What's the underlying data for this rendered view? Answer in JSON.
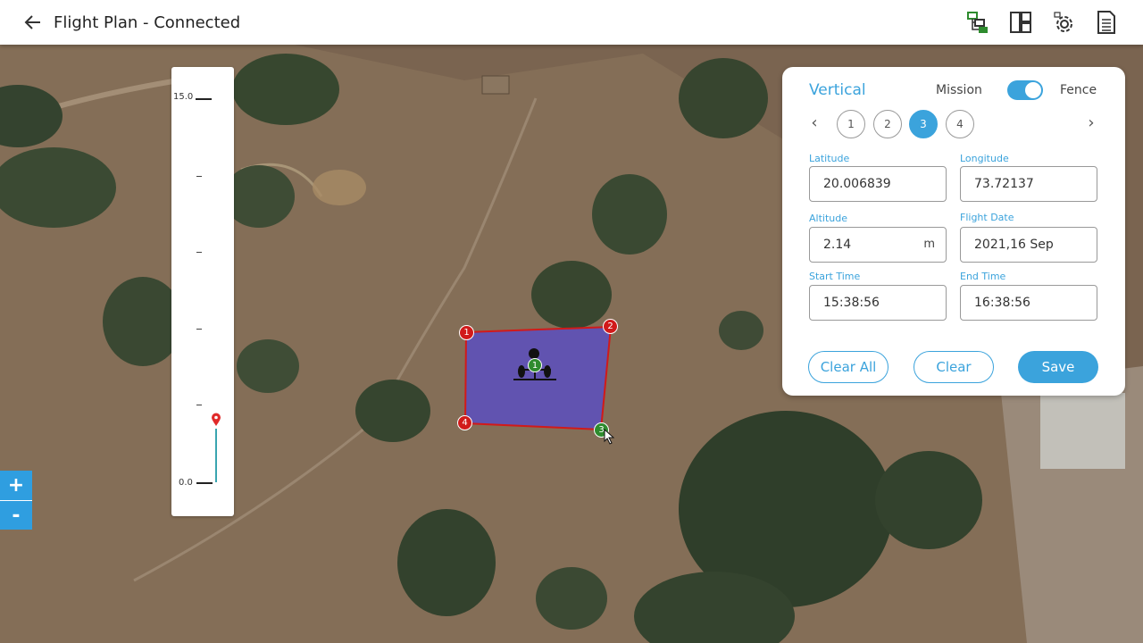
{
  "header": {
    "title": "Flight Plan - Connected"
  },
  "icons": {
    "back": "arrow-left-icon",
    "toolbar": [
      "mission-tree-icon",
      "layout-dashboard-icon",
      "settings-gear-icon",
      "document-list-icon"
    ]
  },
  "altitude_scale": {
    "max_label": "15.0",
    "min_label": "0.0",
    "marker_color": "#e02a2a"
  },
  "zoom": {
    "in_label": "+",
    "out_label": "-"
  },
  "map": {
    "polygon_fill": "#5b4fc0",
    "polygon_stroke": "#d11a1a",
    "vertex_labels": [
      "1",
      "2",
      "3",
      "4"
    ],
    "drone_waypoint_label": "1"
  },
  "panel": {
    "mode_label": "Vertical",
    "mission_label": "Mission",
    "fence_label": "Fence",
    "toggle_on": true,
    "prev_label": "‹",
    "next_label": "›",
    "steps": [
      "1",
      "2",
      "3",
      "4"
    ],
    "active_step": "3",
    "latitude": {
      "label": "Latitude",
      "value": "20.006839"
    },
    "longitude": {
      "label": "Longitude",
      "value": "73.72137"
    },
    "altitude": {
      "label": "Altitude",
      "value": "2.14",
      "unit": "m"
    },
    "flight_date": {
      "label": "Flight Date",
      "value": "2021,16 Sep"
    },
    "start_time": {
      "label": "Start Time",
      "value": "15:38:56"
    },
    "end_time": {
      "label": "End Time",
      "value": "16:38:56"
    },
    "buttons": {
      "clear_all": "Clear All",
      "clear": "Clear",
      "save": "Save"
    }
  },
  "colors": {
    "accent": "#3ba3dc",
    "vertex_red": "#d11a1a",
    "vertex_green": "#2e8b2e"
  }
}
